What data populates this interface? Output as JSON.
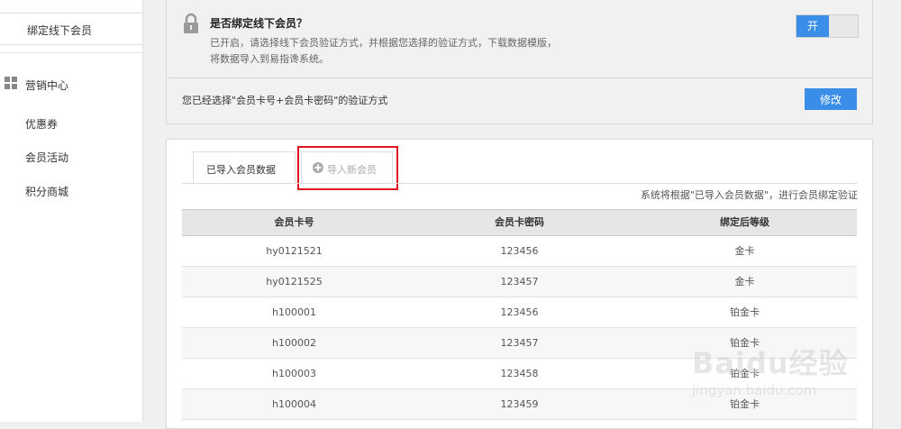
{
  "sidebar": {
    "active_item": "绑定线下会员",
    "group_title": "营销中心",
    "items": [
      "优惠券",
      "会员活动",
      "积分商城"
    ]
  },
  "binding_panel": {
    "title": "是否绑定线下会员？",
    "desc_line1": "已开启，请选择线下会员验证方式，并根据您选择的验证方式，下载数据模版，",
    "desc_line2": "将数据导入到易指谗系统。",
    "toggle_label": "开",
    "selected_text": "您已经选择\"会员卡号+会员卡密码\"的验证方式",
    "modify_label": "修改"
  },
  "tabs": [
    {
      "label": "已导入会员数据"
    },
    {
      "label": "导入新会员",
      "icon": "plus-circle-icon"
    }
  ],
  "note": "系统将根据\"已导入会员数据\"，进行会员绑定验证",
  "table": {
    "headers": [
      "会员卡号",
      "会员卡密码",
      "绑定后等级"
    ],
    "rows": [
      [
        "hy0121521",
        "123456",
        "金卡"
      ],
      [
        "hy0121525",
        "123457",
        "金卡"
      ],
      [
        "h100001",
        "123456",
        "铂金卡"
      ],
      [
        "h100002",
        "123457",
        "铂金卡"
      ],
      [
        "h100003",
        "123458",
        "铂金卡"
      ],
      [
        "h100004",
        "123459",
        "铂金卡"
      ]
    ]
  },
  "watermark": {
    "text": "Baidu经验",
    "sub": "jingyan.baidu.com"
  },
  "colors": {
    "accent": "#3b8ee8",
    "highlight": "#e0141e"
  }
}
